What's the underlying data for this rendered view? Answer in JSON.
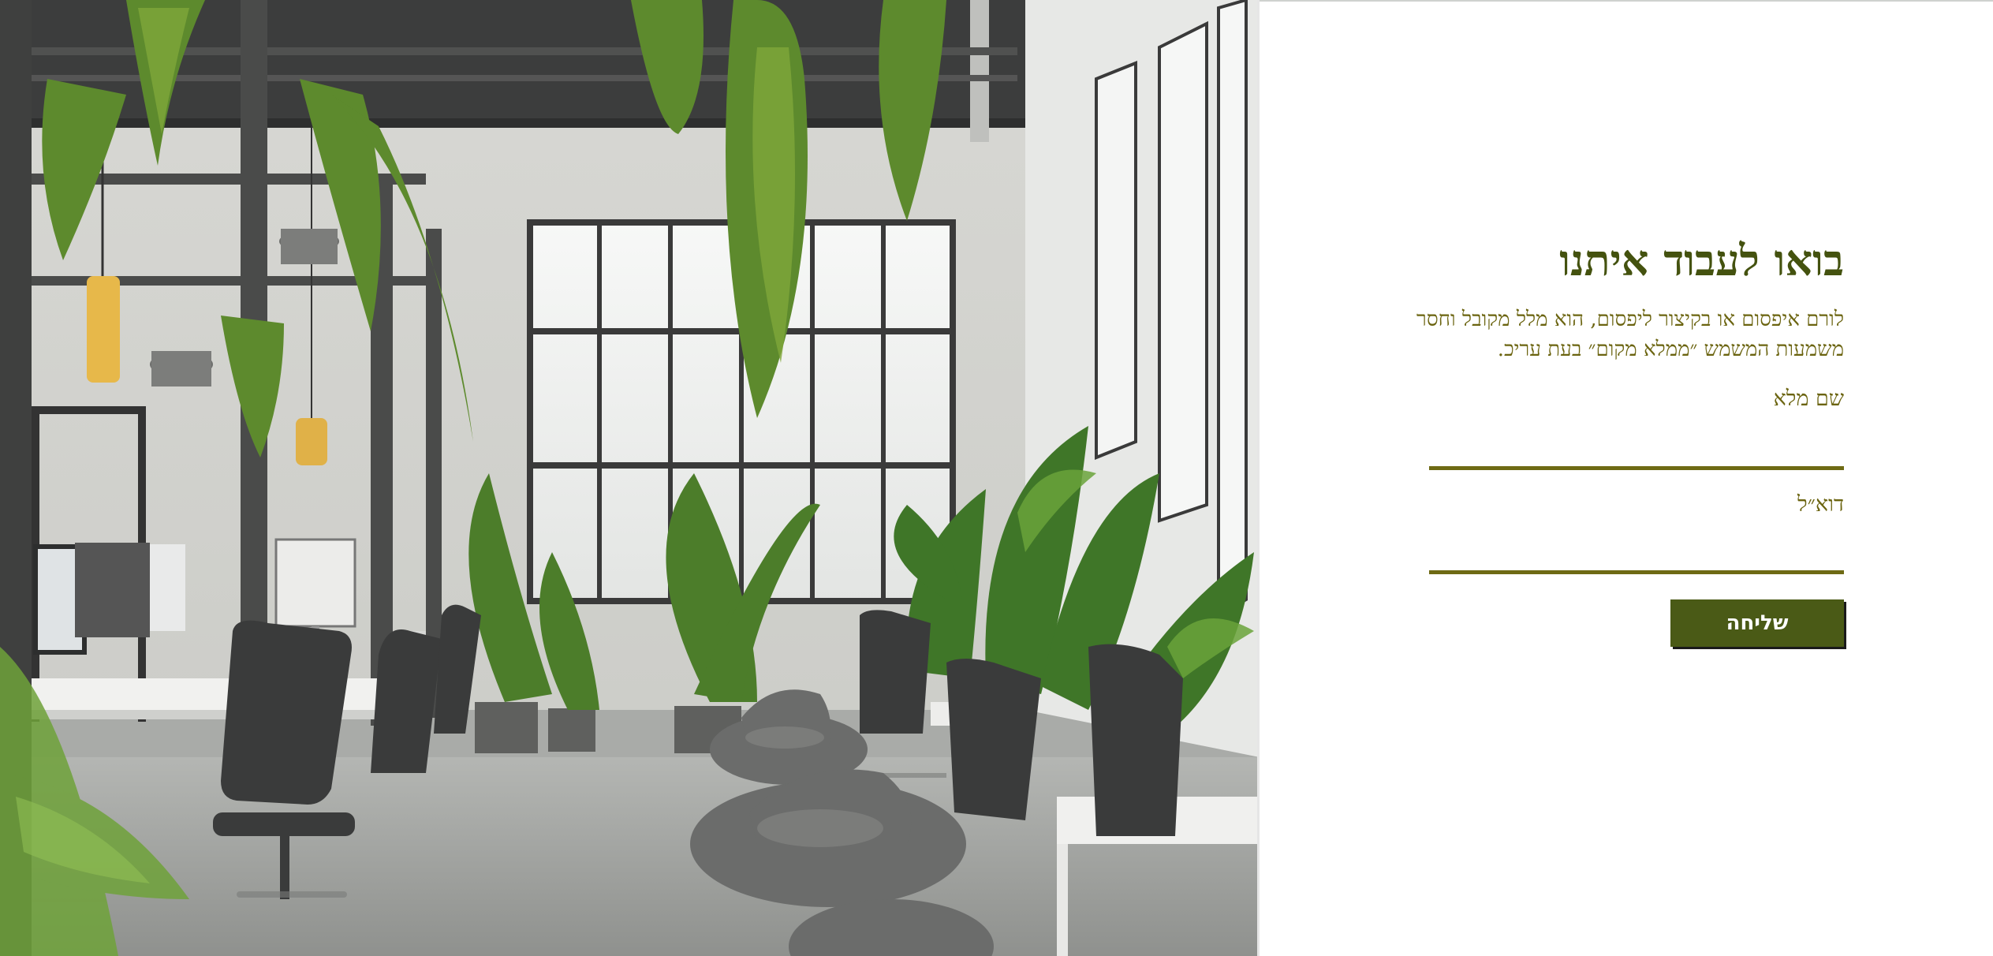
{
  "hero": {
    "image_alt": "Open office space with hanging plants, desks and chairs"
  },
  "form": {
    "title": "בואו לעבוד איתנו",
    "description": "לורם איפסום או בקיצור ליפסום, הוא מלל מקובל וחסר משמעות המשמש ״ממלא מקום״ בעת עריכ.",
    "fields": [
      {
        "label": "שם מלא",
        "value": "",
        "placeholder": ""
      },
      {
        "label": "דוא״ל",
        "value": "",
        "placeholder": ""
      }
    ],
    "submit_label": "שליחה"
  },
  "colors": {
    "title": "#44520f",
    "text": "#6b6410",
    "underline": "#6e6a14",
    "button": "#4a5a16"
  }
}
